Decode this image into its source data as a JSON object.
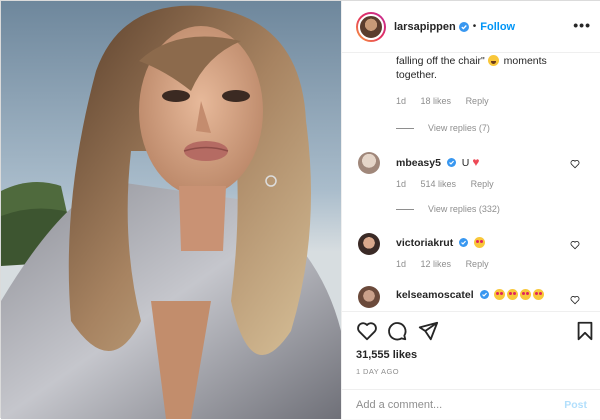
{
  "header": {
    "username": "larsapippen",
    "separator": "•",
    "follow_label": "Follow",
    "more_label": "•••"
  },
  "comments": [
    {
      "user": "",
      "text_line1": "falling off the chair\"",
      "text_line2": "moments",
      "text_line3": "together.",
      "emoji": "laugh",
      "age": "1d",
      "likes": "18 likes",
      "reply": "Reply",
      "view_replies": "View replies (7)"
    },
    {
      "user": "mbeasy5",
      "text": "U",
      "emoji": "red-heart",
      "age": "1d",
      "likes": "514 likes",
      "reply": "Reply",
      "view_replies": "View replies (332)"
    },
    {
      "user": "victoriakrut",
      "emoji": "heart-eyes",
      "age": "1d",
      "likes": "12 likes",
      "reply": "Reply"
    },
    {
      "user": "kelseamoscatel",
      "emoji": "heart-eyes x4"
    }
  ],
  "actions": {
    "likes": "31,555 likes",
    "time": "1 DAY AGO",
    "icons": [
      "heart-icon",
      "comment-icon",
      "share-icon",
      "bookmark-icon"
    ]
  },
  "add_comment": {
    "placeholder": "Add a comment...",
    "post_label": "Post"
  },
  "colors": {
    "link_blue": "#0095f6",
    "muted": "#8e8e8e",
    "post_disabled": "#b2dffc"
  }
}
